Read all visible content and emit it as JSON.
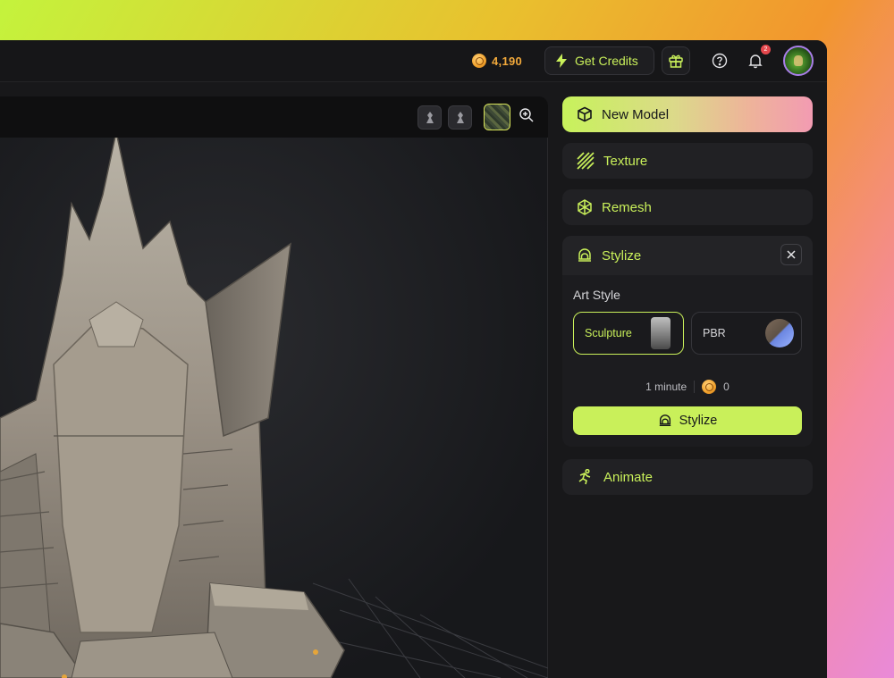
{
  "topbar": {
    "credits": "4,190",
    "get_credits_label": "Get Credits",
    "notification_count": "2"
  },
  "sidebar": {
    "new_model_label": "New Model",
    "texture_label": "Texture",
    "remesh_label": "Remesh",
    "stylize": {
      "title": "Stylize",
      "art_style_label": "Art Style",
      "options": [
        {
          "label": "Sculpture",
          "selected": true
        },
        {
          "label": "PBR",
          "selected": false
        }
      ],
      "duration": "1 minute",
      "cost": "0",
      "button_label": "Stylize"
    },
    "animate_label": "Animate"
  },
  "colors": {
    "accent": "#c9f05a",
    "credits": "#f2a93b"
  }
}
